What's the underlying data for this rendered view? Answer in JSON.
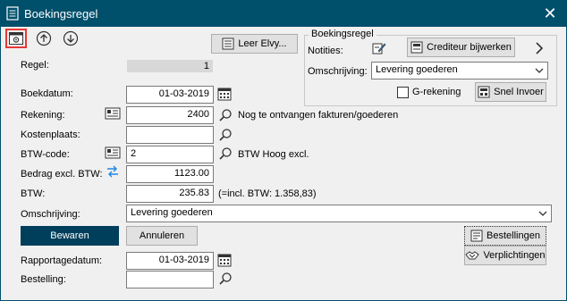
{
  "window": {
    "title": "Boekingsregel",
    "close_glyph": "✕"
  },
  "toolbar": {
    "leer_label": "Leer Elvy..."
  },
  "group": {
    "title": "Boekingsregel",
    "notities_label": "Notities:",
    "crediteur_label": "Crediteur bijwerken",
    "omschrijving_label": "Omschrijving:",
    "omschrijving_value": "Levering goederen",
    "grekening_label": "G-rekening",
    "snel_label": "Snel Invoer"
  },
  "form": {
    "regel_label": "Regel:",
    "regel_value": "1",
    "boekdatum_label": "Boekdatum:",
    "boekdatum_value": "01-03-2019",
    "rekening_label": "Rekening:",
    "rekening_value": "2400",
    "rekening_desc": "Nog te ontvangen fakturen/goederen",
    "kostenplaats_label": "Kostenplaats:",
    "kostenplaats_value": "",
    "btwcode_label": "BTW-code:",
    "btwcode_value": "2",
    "btwcode_desc": "BTW Hoog excl.",
    "bedrag_label": "Bedrag excl. BTW:",
    "bedrag_value": "1123.00",
    "btw_label": "BTW:",
    "btw_value": "235.83",
    "btw_incl": "(=incl. BTW: 1.358,83)",
    "omschrijving_label": "Omschrijving:",
    "omschrijving_value": "Levering goederen",
    "rapportage_label": "Rapportagedatum:",
    "rapportage_value": "01-03-2019",
    "bestelling_label": "Bestelling:",
    "bestelling_value": ""
  },
  "buttons": {
    "bewaren": "Bewaren",
    "annuleren": "Annuleren",
    "bestellingen": "Bestellingen",
    "verplichtingen": "Verplichtingen"
  },
  "colors": {
    "titlebar": "#004f6b",
    "primary_button": "#003f5c",
    "highlight_border": "#e53935"
  }
}
